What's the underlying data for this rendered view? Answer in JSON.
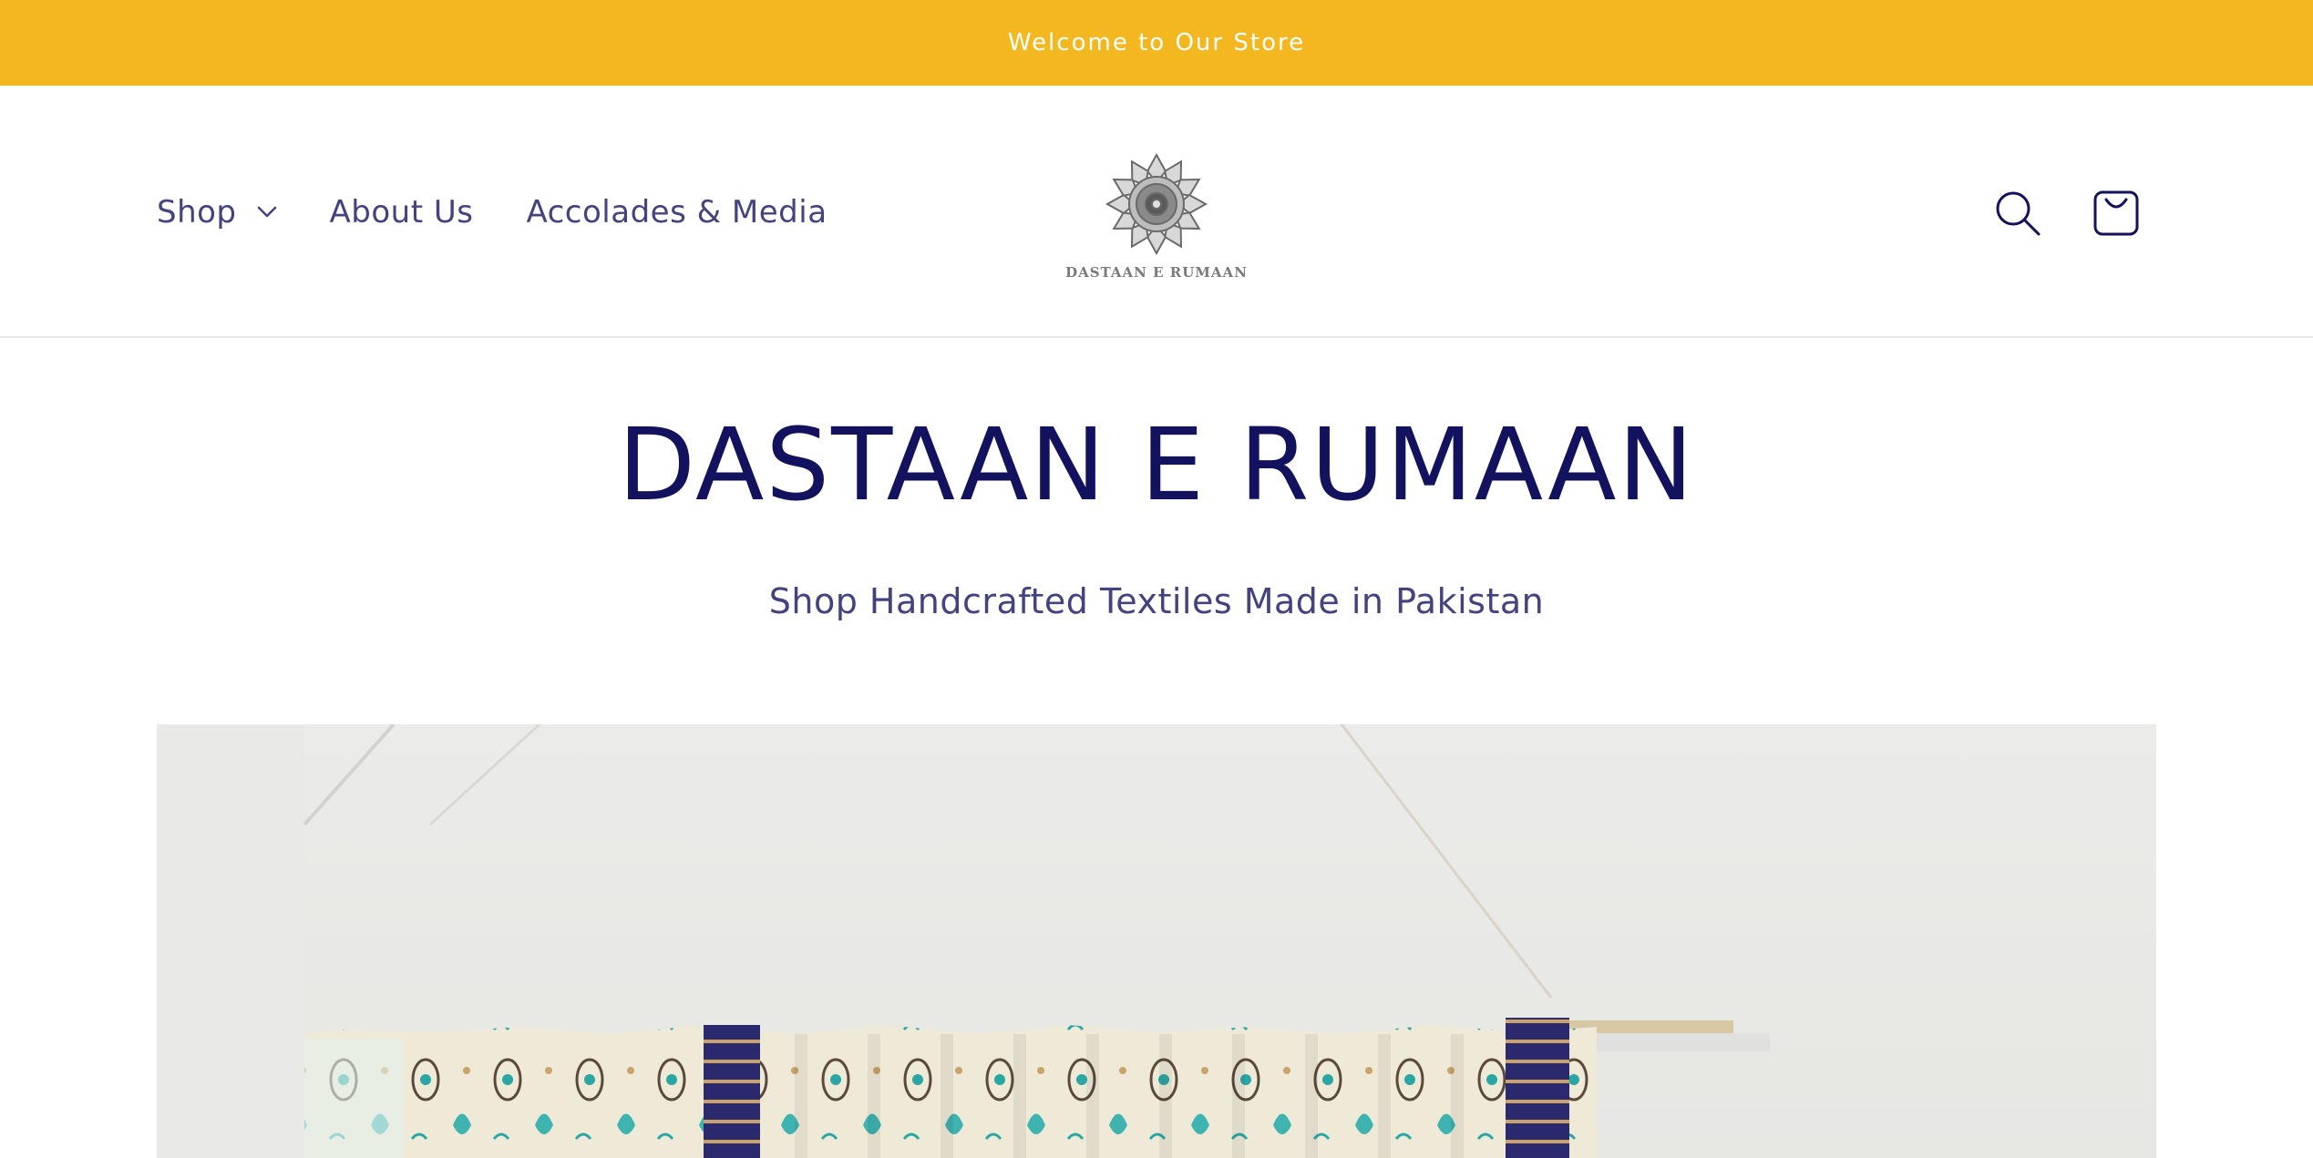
{
  "announcement": {
    "text": "Welcome to Our Store"
  },
  "header": {
    "nav": [
      {
        "label": "Shop",
        "has_dropdown": true,
        "icon": "chevron-down-icon"
      },
      {
        "label": "About Us",
        "has_dropdown": false
      },
      {
        "label": "Accolades & Media",
        "has_dropdown": false
      }
    ],
    "logo_text": "DASTAAN E RUMAAN",
    "icons": [
      "search-icon",
      "cart-icon"
    ]
  },
  "hero": {
    "title": "DASTAAN E RUMAAN",
    "subtitle": "Shop Handcrafted Textiles Made in Pakistan",
    "image_description_icon": "hanging-textile-image"
  },
  "colors": {
    "announcement_bg": "#F3B81F",
    "announcement_text": "#ffffff",
    "nav_text": "#43437f",
    "title_text": "#12125e",
    "icon_stroke": "#12125e",
    "image_bg": "#e9e9e7"
  }
}
